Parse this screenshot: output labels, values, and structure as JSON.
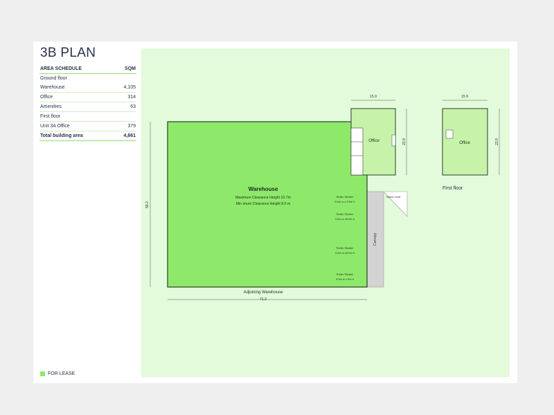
{
  "title": "3B PLAN",
  "schedule": {
    "header": {
      "label": "AREA SCHEDULE",
      "unit": "SQM"
    },
    "ground_floor": "Ground floor",
    "ground_rows": [
      {
        "label": "Warehouse",
        "value": "4,105"
      },
      {
        "label": "Office",
        "value": "314"
      },
      {
        "label": "Amenities",
        "value": "63"
      }
    ],
    "first_floor": "First floor",
    "first_rows": [
      {
        "label": "Unit 3A Office",
        "value": "379"
      }
    ],
    "total": {
      "label": "Total building area",
      "value": "4,861"
    }
  },
  "plan": {
    "warehouse_label": "Warehouse",
    "clearance_max": "Maximum Clearance Height 10.7m",
    "clearance_min": "Min imum Clearance Height    9.0  m",
    "office_label": "Office",
    "first_floor_office_label": "Office",
    "first_floor_caption": "First floor",
    "adjoining": "Adjoining Warehouse",
    "canopy": "Canopy",
    "system_note": "System Node",
    "dim_width": "71.2",
    "dim_height": "58.2",
    "dim_office_w": "15.9",
    "dim_office_h": "23.9",
    "dim_ff_w": "15.9",
    "dim_ff_h": "23.9",
    "shutters": [
      {
        "title": "Roller Shutter",
        "size": "5.0m w x 5.5m h"
      },
      {
        "title": "Roller Shutter",
        "size": "4.0m w x5.0m h"
      },
      {
        "title": "Roller Shutter",
        "size": "4.0m w x5.0m h"
      },
      {
        "title": "Roller Shutter",
        "size": "4.0m w x 5m h"
      }
    ]
  },
  "legend": {
    "label": "FOR LEASE",
    "color": "#8ee96a"
  },
  "colors": {
    "lease_fill": "#8ee96a",
    "office_fill": "#c6f3a9",
    "plan_bg": "#e3fadb",
    "canopy": "#d3d3d3"
  }
}
